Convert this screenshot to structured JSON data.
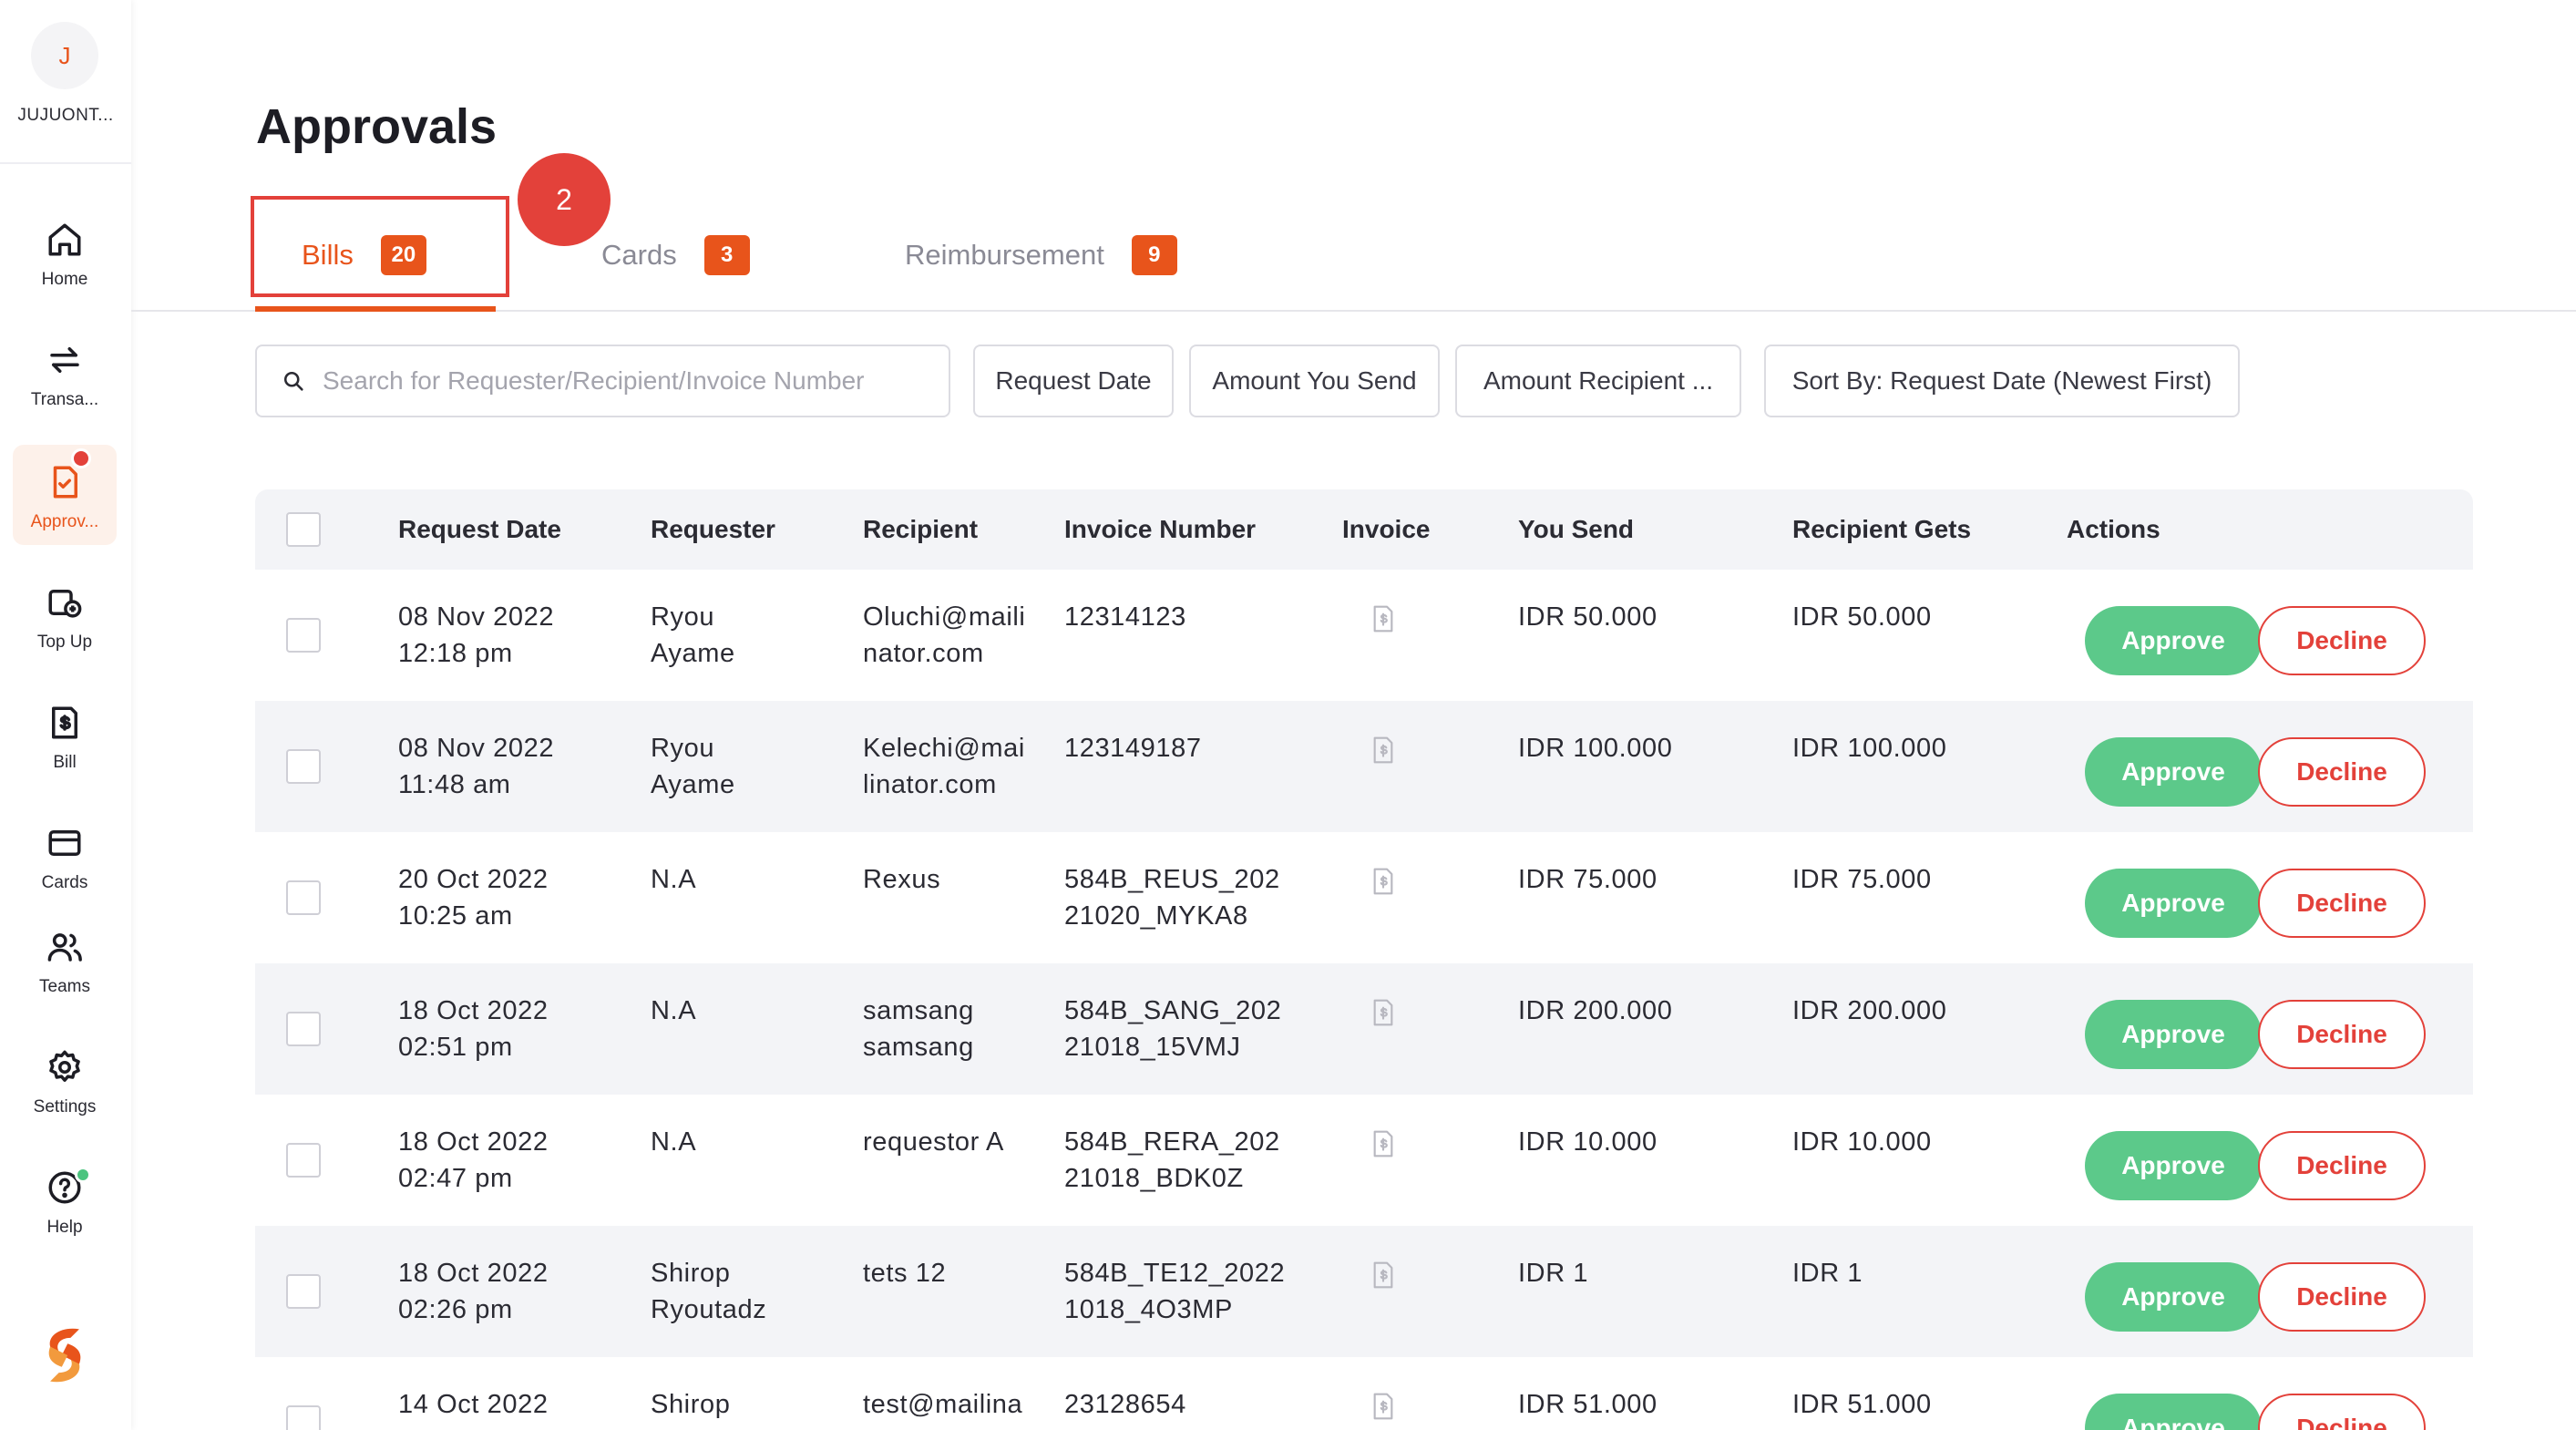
{
  "sidebar": {
    "avatar_initial": "J",
    "username": "JUJUONT...",
    "items": [
      {
        "label": "Home"
      },
      {
        "label": "Transa..."
      },
      {
        "label": "Approv..."
      },
      {
        "label": "Top Up"
      },
      {
        "label": "Bill"
      },
      {
        "label": "Cards"
      },
      {
        "label": "Teams"
      },
      {
        "label": "Settings"
      },
      {
        "label": "Help"
      }
    ]
  },
  "page": {
    "title": "Approvals"
  },
  "tabs": [
    {
      "label": "Bills",
      "count": "20"
    },
    {
      "label": "Cards",
      "count": "3"
    },
    {
      "label": "Reimbursement",
      "count": "9"
    }
  ],
  "step_badge": "2",
  "filters": {
    "search_placeholder": "Search for Requester/Recipient/Invoice Number",
    "request_date": "Request Date",
    "amount_you_send": "Amount You Send",
    "amount_recipient": "Amount Recipient ...",
    "sort_by": "Sort By: Request Date (Newest First)"
  },
  "table": {
    "headers": {
      "request_date": "Request Date",
      "requester": "Requester",
      "recipient": "Recipient",
      "invoice_number": "Invoice Number",
      "invoice": "Invoice",
      "you_send": "You Send",
      "recipient_gets": "Recipient Gets",
      "actions": "Actions"
    },
    "approve_label": "Approve",
    "decline_label": "Decline",
    "rows": [
      {
        "date": "08 Nov 2022",
        "time": "12:18 pm",
        "req1": "Ryou",
        "req2": "Ayame",
        "rec1": "Oluchi@maili",
        "rec2": "nator.com",
        "inv1": "12314123",
        "inv2": "",
        "send": "IDR 50.000",
        "gets": "IDR 50.000"
      },
      {
        "date": "08 Nov 2022",
        "time": "11:48 am",
        "req1": "Ryou",
        "req2": "Ayame",
        "rec1": "Kelechi@mai",
        "rec2": "linator.com",
        "inv1": "123149187",
        "inv2": "",
        "send": "IDR 100.000",
        "gets": "IDR 100.000"
      },
      {
        "date": "20 Oct 2022",
        "time": "10:25 am",
        "req1": "N.A",
        "req2": "",
        "rec1": "Rexus",
        "rec2": "",
        "inv1": "584B_REUS_202",
        "inv2": "21020_MYKA8",
        "send": "IDR 75.000",
        "gets": "IDR 75.000"
      },
      {
        "date": "18 Oct 2022",
        "time": "02:51 pm",
        "req1": "N.A",
        "req2": "",
        "rec1": "samsang",
        "rec2": "samsang",
        "inv1": "584B_SANG_202",
        "inv2": "21018_15VMJ",
        "send": "IDR 200.000",
        "gets": "IDR 200.000"
      },
      {
        "date": "18 Oct 2022",
        "time": "02:47 pm",
        "req1": "N.A",
        "req2": "",
        "rec1": "requestor A",
        "rec2": "",
        "inv1": "584B_RERA_202",
        "inv2": "21018_BDK0Z",
        "send": "IDR 10.000",
        "gets": "IDR 10.000"
      },
      {
        "date": "18 Oct 2022",
        "time": "02:26 pm",
        "req1": "Shirop",
        "req2": "Ryoutadz",
        "rec1": "tets 12",
        "rec2": "",
        "inv1": "584B_TE12_2022",
        "inv2": "1018_4O3MP",
        "send": "IDR 1",
        "gets": "IDR 1"
      },
      {
        "date": "14 Oct 2022",
        "time": "",
        "req1": "Shirop",
        "req2": "",
        "rec1": "test@mailina",
        "rec2": "",
        "inv1": "23128654",
        "inv2": "",
        "send": "IDR 51.000",
        "gets": "IDR 51.000"
      }
    ]
  },
  "colors": {
    "accent": "#e8541b",
    "approve": "#5cc98a",
    "decline": "#e3413a",
    "header_bg": "#f3f4f7"
  }
}
